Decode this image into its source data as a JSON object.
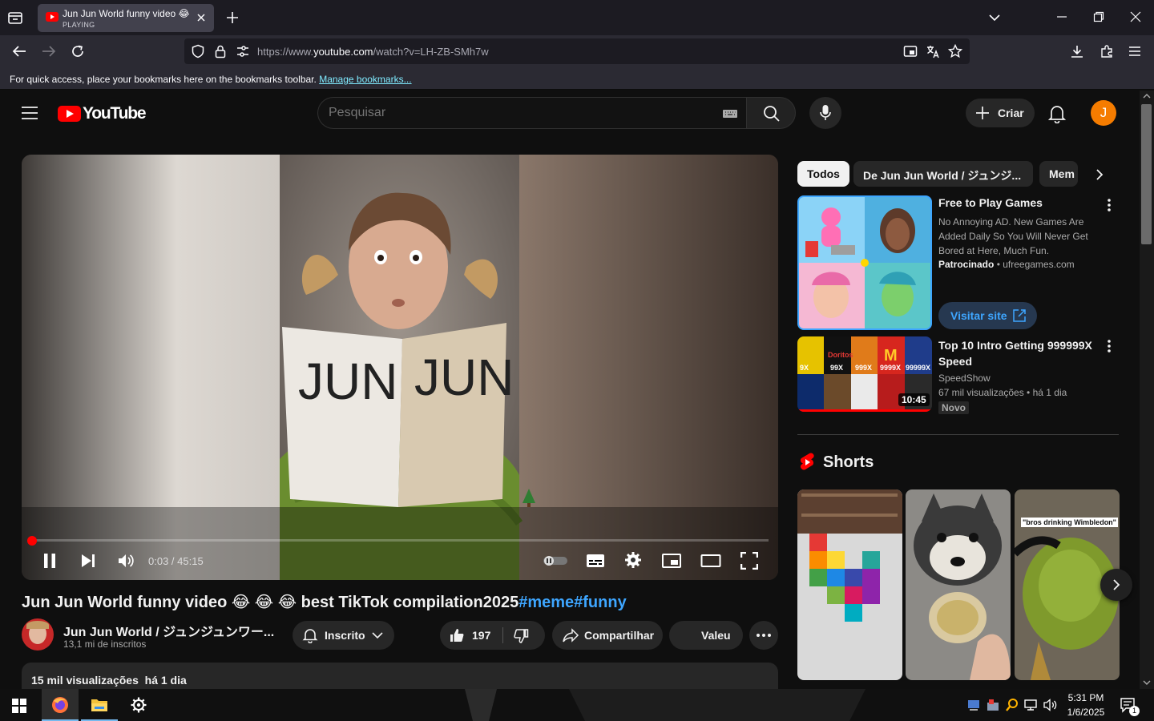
{
  "browser": {
    "tab": {
      "title": "Jun Jun World funny video 😂 😂",
      "status": "PLAYING"
    },
    "url": {
      "prefix": "https://www.",
      "domain": "youtube.com",
      "path": "/watch?v=LH-ZB-SMh7w"
    },
    "bookmarks_bar": {
      "message": "For quick access, place your bookmarks here on the bookmarks toolbar.",
      "link": "Manage bookmarks..."
    }
  },
  "youtube": {
    "logo_text": "YouTube",
    "search": {
      "placeholder": "Pesquisar"
    },
    "create_label": "Criar",
    "avatar_letter": "J",
    "player": {
      "time": "0:03 / 45:15",
      "progress": 0.001,
      "overlay_text": "JUN JUN"
    },
    "video": {
      "title_plain": "Jun Jun World funny video 😂 😂 😂 best TikTok compilation2025",
      "hashtags": "#meme#funny",
      "channel": "Jun Jun World / ジュンジュンワー...",
      "subscribers": "13,1 mi de inscritos",
      "subscribe_label": "Inscrito",
      "likes": "197",
      "share_label": "Compartilhar",
      "thanks_label": "Valeu",
      "views": "15 mil visualizações",
      "published": "há 1 dia"
    },
    "chips": [
      "Todos",
      "De Jun Jun World / ジュンジ...",
      "Mem"
    ],
    "ad": {
      "title": "Free to Play Games",
      "description": "No Annoying AD. New Games Are Added Daily So You Will Never Get Bored at Here, Much Fun.",
      "sponsored": "Patrocinado",
      "domain": "ufreegames.com",
      "cta": "Visitar site"
    },
    "recommended": {
      "title": "Top 10 Intro Getting 999999X Speed",
      "channel": "SpeedShow",
      "meta": "67 mil visualizações • há 1 dia",
      "badge": "Novo",
      "duration": "10:45",
      "thumb_labels": [
        "9X",
        "99X",
        "999X",
        "9999X",
        "99999X"
      ]
    },
    "shorts": {
      "heading": "Shorts",
      "third_caption": "\"bros drinking Wimbledon\""
    }
  },
  "taskbar": {
    "time": "5:31 PM",
    "date": "1/6/2025",
    "notifications": "1"
  },
  "colors": {
    "accent_red": "#ff0000",
    "link_blue": "#3ea6ff",
    "avatar_orange": "#f57c00"
  }
}
